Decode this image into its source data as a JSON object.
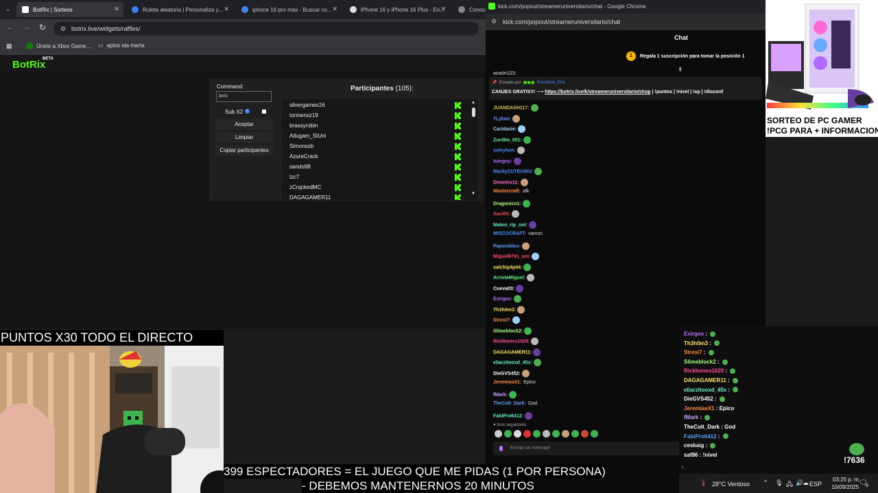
{
  "browser": {
    "tabs": [
      {
        "label": "BotRix | Sorteos",
        "color": "#ffffff",
        "active": true
      },
      {
        "label": "Ruleta aleatoria | Personaliza y...",
        "color": "#3b82f6",
        "active": false
      },
      {
        "label": "iphone 16 pro max - Buscar co...",
        "color": "#4285f4",
        "active": false
      },
      {
        "label": "iPhone 16 y iPhone 16 Plus - En...",
        "color": "#dddddd",
        "active": false
      },
      {
        "label": "Conoce",
        "color": "#888888",
        "active": false
      }
    ],
    "url": "botrix.live/widgets/raffles/",
    "bookmarks": [
      "Únete a Xbox Game...",
      "aptos sta marta"
    ]
  },
  "botrix": {
    "logo": "BotRix",
    "badge": "BETA",
    "command_label": "Command:",
    "command_value": "laris",
    "subx2_label": "Sub X2",
    "accept_label": "Aceptar",
    "clear_label": "Limpiar",
    "copy_label": "Copiar participantes",
    "participants_title": "Participantes",
    "participants_count": "(105):",
    "participants": [
      "silvergames16",
      "tormenxz19",
      "brassyrobin",
      "Atlugam_StUni",
      "Simonssb",
      "AzureCrack",
      "sando98",
      "lzc7",
      "zCrqckedMC",
      "DAGAGAMER11"
    ]
  },
  "chat_window": {
    "title": "kick.com/popout/streameruniversitario/chat - Google Chrome",
    "url": "kick.com/popout/streameruniversitario/chat",
    "header": "Chat",
    "gift_text": "Regala 1 suscripción para tomar la posición 1",
    "gift_rank": "1",
    "pinned_by": "Enviado por",
    "pinned_user": "PzeroKick_Emi",
    "pinned_prefix": "CANJES GRATIS!!!",
    "pinned_link": "https://botrix.live/k/streameruniversitario/shop",
    "pinned_suffix": "| !puntos | !nivel | !xp | !discord",
    "top_cut_user": "azadn123:",
    "messages": [
      {
        "user": "JUANDASH117:",
        "text": "",
        "color": "#e8c05a"
      },
      {
        "user": "7Lykan:",
        "text": "",
        "color": "#5a9ef5"
      },
      {
        "user": "Caridanie:",
        "text": "",
        "color": "#9ed1ff"
      },
      {
        "user": "Zurdito_001:",
        "text": "",
        "color": "#5ff58a"
      },
      {
        "user": "suleylum:",
        "text": "",
        "color": "#4a8dff"
      },
      {
        "user": "tumgoy:",
        "text": "",
        "color": "#c26bff"
      },
      {
        "user": "MarilyCUTEUWU:",
        "text": "",
        "color": "#4a8dff"
      },
      {
        "user": "Dimetrix11:",
        "text": "",
        "color": "#ff6ad5"
      },
      {
        "user": "Mastercraft:",
        "text": "afk",
        "color": "#ff8a3d"
      },
      {
        "user": "Dragonico1:",
        "text": "",
        "color": "#a8ff7a"
      },
      {
        "user": "Xavi0V:",
        "text": "",
        "color": "#ff4a4a"
      },
      {
        "user": "Mateo_rip_uni:",
        "text": "",
        "color": "#5ff5c8"
      },
      {
        "user": "MISCOCRAFT:",
        "text": "vamos",
        "color": "#4a8dff"
      },
      {
        "user": "Papsrobles:",
        "text": "",
        "color": "#5a9ef5"
      },
      {
        "user": "Miguel8791_uni:",
        "text": "",
        "color": "#ff4a6a"
      },
      {
        "user": "salchip4p44:",
        "text": "",
        "color": "#ffe25a"
      },
      {
        "user": "ArrietaMiguel:",
        "text": "",
        "color": "#5ff58a"
      },
      {
        "user": "Cueva03:",
        "text": "",
        "color": "#ffffff"
      },
      {
        "user": "Exirgos:",
        "text": "",
        "color": "#c26bff"
      },
      {
        "user": "Th3h0m3:",
        "text": "",
        "color": "#ffe25a"
      },
      {
        "user": "Strexi7:",
        "text": "",
        "color": "#ff8a3d"
      },
      {
        "user": "Slimeblock2:",
        "text": "",
        "color": "#a8ff7a"
      },
      {
        "user": "Rickbones1029:",
        "text": "",
        "color": "#ff4a9e"
      },
      {
        "user": "DAGAGAMER11:",
        "text": "",
        "color": "#ffe25a"
      },
      {
        "user": "eliarzitooxd_45x:",
        "text": "",
        "color": "#5ff5c8"
      },
      {
        "user": "DieGVS452:",
        "text": "",
        "color": "#ffffff"
      },
      {
        "user": "JeremiasX1:",
        "text": "Epico",
        "color": "#ff8a3d"
      },
      {
        "user": "fMark:",
        "text": "",
        "color": "#c9a0ff"
      },
      {
        "user": "TheColt_Dark:",
        "text": "God",
        "color": "#5a9ef5"
      },
      {
        "user": "FabiPro6412:",
        "text": "",
        "color": "#5ff5c8"
      }
    ],
    "followers_only": "Solo seguidores",
    "input_placeholder": "Enviar un mensaje"
  },
  "overlay_chat": [
    {
      "user": "Exirgos",
      "text": "",
      "color": "#c26bff"
    },
    {
      "user": "Th3h0m3",
      "text": "",
      "color": "#ffe25a"
    },
    {
      "user": "Strexi7",
      "text": "",
      "color": "#ff8a3d"
    },
    {
      "user": "Slimeblock2",
      "text": "",
      "color": "#a8ff7a"
    },
    {
      "user": "Rickbones1029",
      "text": "",
      "color": "#ff4a9e"
    },
    {
      "user": "DAGAGAMER11",
      "text": "",
      "color": "#ffe25a"
    },
    {
      "user": "eliarzitooxd_45x",
      "text": "",
      "color": "#5ff5c8"
    },
    {
      "user": "DieGVS452",
      "text": "",
      "color": "#ffffff"
    },
    {
      "user": "JeremiasX1",
      "text": "Epico",
      "color": "#ff8a3d"
    },
    {
      "user": "fMark",
      "text": "",
      "color": "#c9a0ff"
    },
    {
      "user": "TheColt_Dark",
      "text": "God",
      "color": "#ffffff"
    },
    {
      "user": "FabiPro6412",
      "text": "",
      "color": "#5a9ef5"
    },
    {
      "user": "ceskaig",
      "text": "",
      "color": "#ffffff"
    },
    {
      "user": "saf86",
      "text": "!nivel",
      "color": "#ffffff"
    }
  ],
  "promo": {
    "line1": "SORTEO DE PC GAMER",
    "line2": "!PCG PARA + INFORMACION"
  },
  "stream_overlay": {
    "points_banner": "PUNTOS X30 TODO EL DIRECTO",
    "viewers_line1": "399 ESPECTADORES = EL JUEGO QUE ME PIDAS (1 POR PERSONA)",
    "viewers_line2": "- DEBEMOS MANTENERNOS 20 MINUTOS",
    "counter": "!7636"
  },
  "taskbar": {
    "weather": "28°C  Ventoso",
    "lang": "ESP",
    "time": "03:25 p. m.",
    "date": "10/09/2025",
    "notif_count": "8",
    "accent": "#53fc18"
  }
}
